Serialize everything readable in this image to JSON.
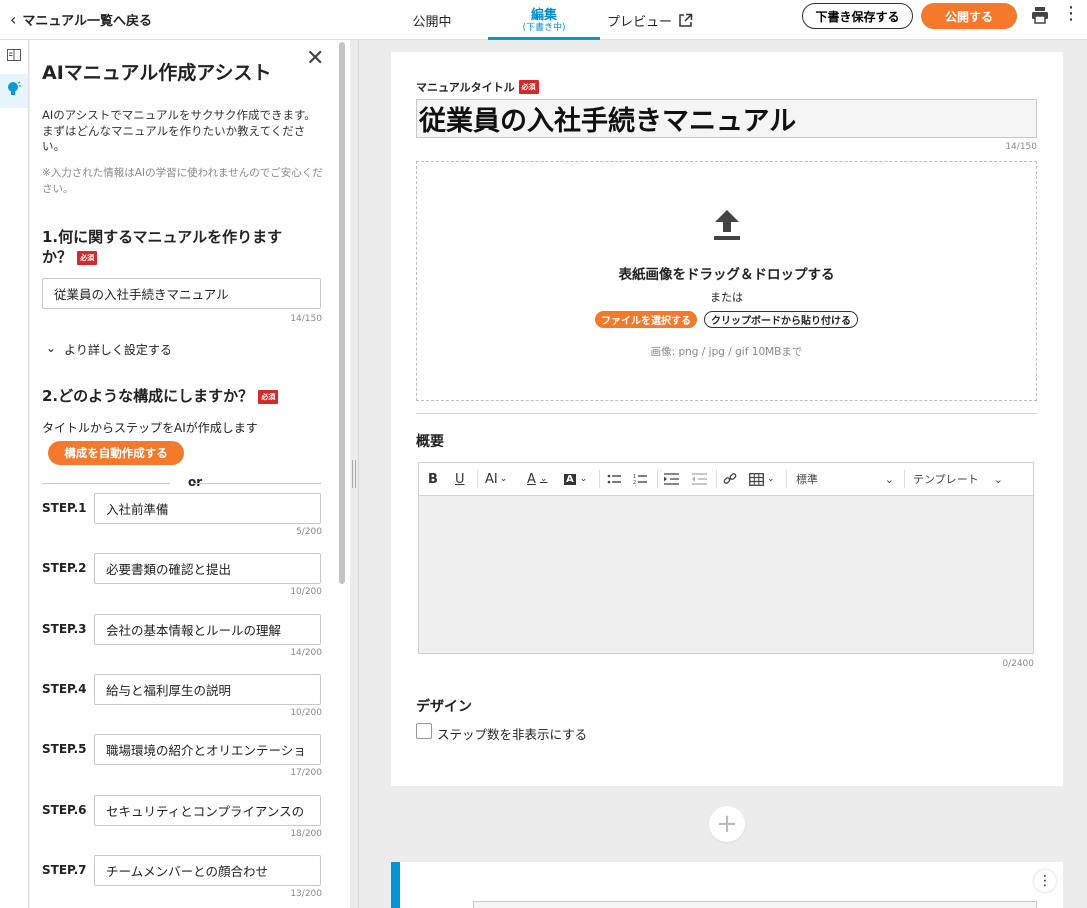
{
  "topbar": {
    "back_label": "マニュアル一覧へ戻る",
    "tabs": {
      "public": "公開中",
      "edit": "編集",
      "edit_sub": "(下書き中)",
      "preview": "プレビュー"
    },
    "save_draft": "下書き保存する",
    "publish": "公開する"
  },
  "ai_panel": {
    "title": "AIマニュアル作成アシスト",
    "intro": "AIのアシストでマニュアルをサクサク作成できます。まずはどんなマニュアルを作りたいか教えてください。",
    "note": "※入力された情報はAIの学習に使われませんのでご安心ください。",
    "q1": "1.何に関するマニュアルを作りますか？",
    "required": "必須",
    "topic_value": "従業員の入社手続きマニュアル",
    "topic_count": "14/150",
    "detail_toggle": "より詳しく設定する",
    "q2": "2.どのような構成にしますか？",
    "q2_desc": "タイトルからステップをAIが作成します",
    "auto_button": "構成を自動作成する",
    "or": "or",
    "steps": [
      {
        "label": "STEP.1",
        "value": "入社前準備",
        "count": "5/200"
      },
      {
        "label": "STEP.2",
        "value": "必要書類の確認と提出",
        "count": "10/200"
      },
      {
        "label": "STEP.3",
        "value": "会社の基本情報とルールの理解",
        "count": "14/200"
      },
      {
        "label": "STEP.4",
        "value": "給与と福利厚生の説明",
        "count": "10/200"
      },
      {
        "label": "STEP.5",
        "value": "職場環境の紹介とオリエンテーショ",
        "count": "17/200"
      },
      {
        "label": "STEP.6",
        "value": "セキュリティとコンプライアンスの",
        "count": "18/200"
      },
      {
        "label": "STEP.7",
        "value": "チームメンバーとの顔合わせ",
        "count": "13/200"
      }
    ]
  },
  "editor": {
    "title_label": "マニュアルタイトル",
    "required": "必須",
    "title_value": "従業員の入社手続きマニュアル",
    "title_count": "14/150",
    "dropzone": {
      "title": "表紙画像をドラッグ＆ドロップする",
      "or": "または",
      "select_file": "ファイルを選択する",
      "paste_clipboard": "クリップボードから貼り付ける",
      "hint": "画像: png / jpg / gif 10MBまで"
    },
    "summary_label": "概要",
    "toolbar": {
      "style_select": "標準",
      "template_select": "テンプレート"
    },
    "summary_count": "0/2400",
    "design_label": "デザイン",
    "hide_steps_label": "ステップ数を非表示にする"
  },
  "colors": {
    "accent_orange": "#f4792b",
    "tab_blue": "#0090d0",
    "required_red": "#d02a2a",
    "step_bar_blue": "#0096d6"
  }
}
